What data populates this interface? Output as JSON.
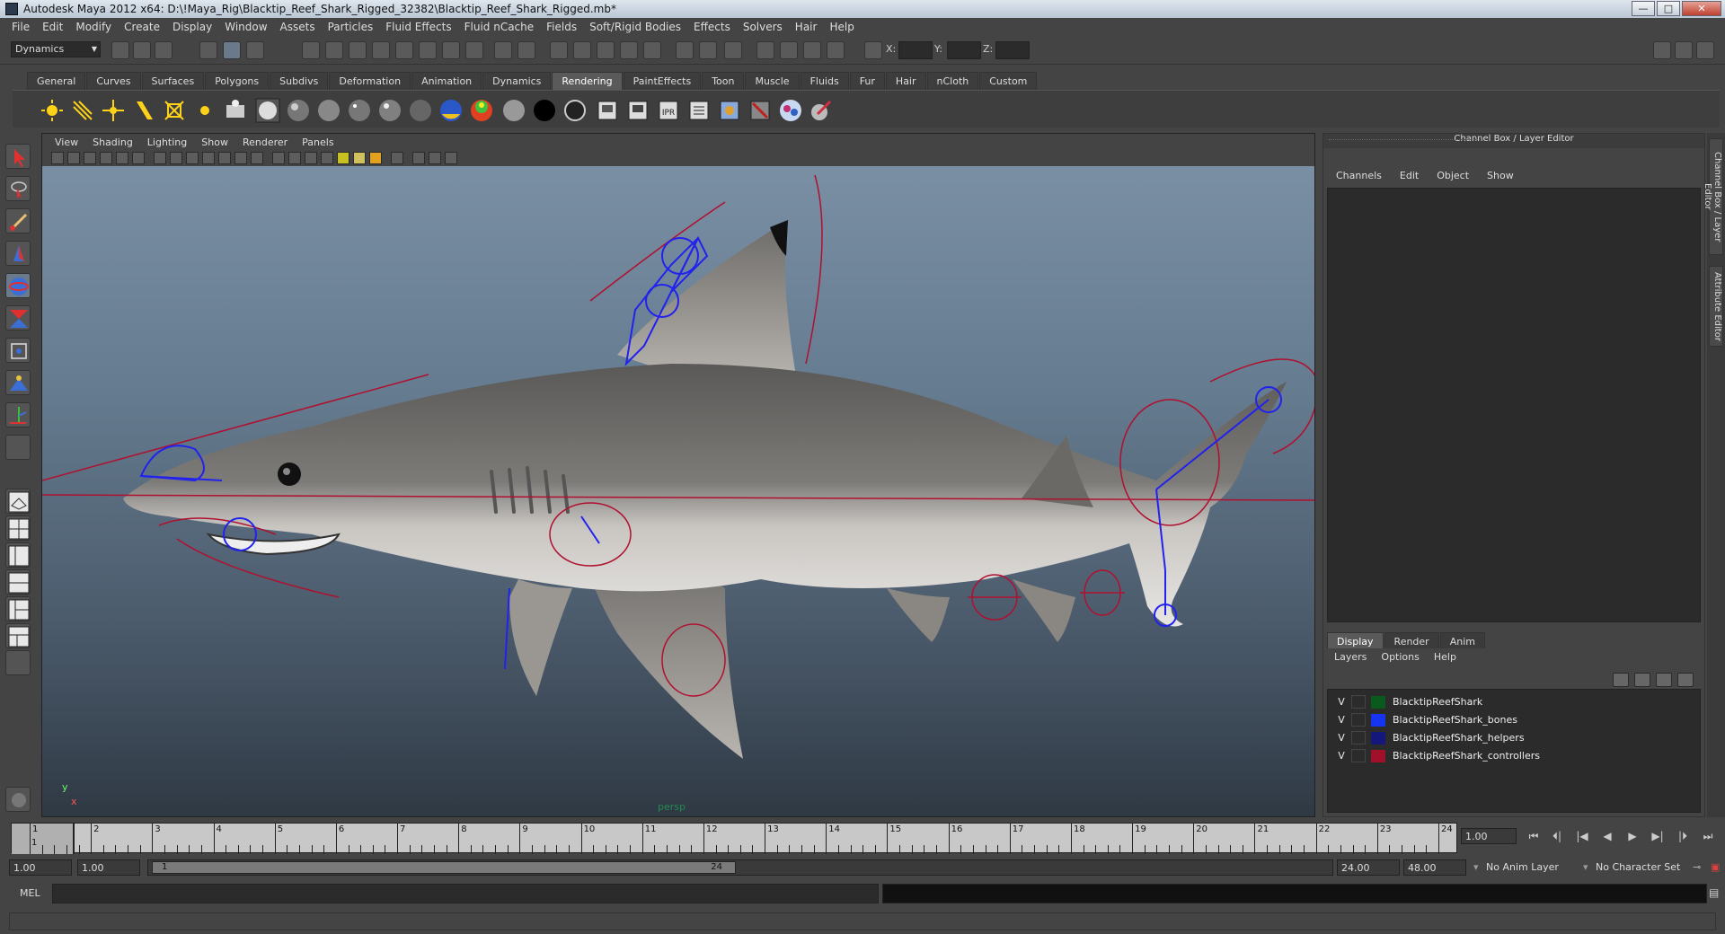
{
  "window": {
    "title": "Autodesk Maya 2012 x64: D:\\!Maya_Rig\\Blacktip_Reef_Shark_Rigged_32382\\Blacktip_Reef_Shark_Rigged.mb*",
    "minimize_label": "—",
    "maximize_label": "□",
    "close_label": "✕"
  },
  "menubar": [
    "File",
    "Edit",
    "Modify",
    "Create",
    "Display",
    "Window",
    "Assets",
    "Particles",
    "Fluid Effects",
    "Fluid nCache",
    "Fields",
    "Soft/Rigid Bodies",
    "Effects",
    "Solvers",
    "Hair",
    "Help"
  ],
  "statusline": {
    "mode": "Dynamics",
    "x_label": "X:",
    "y_label": "Y:",
    "z_label": "Z:"
  },
  "shelf": {
    "tabs": [
      "General",
      "Curves",
      "Surfaces",
      "Polygons",
      "Subdivs",
      "Deformation",
      "Animation",
      "Dynamics",
      "Rendering",
      "PaintEffects",
      "Toon",
      "Muscle",
      "Fluids",
      "Fur",
      "Hair",
      "nCloth",
      "Custom"
    ],
    "active_tab": "Rendering",
    "icons": [
      "ambient-light",
      "directional-light",
      "point-light",
      "spot-light",
      "area-light",
      "volume-light",
      "hypershade",
      "render-sphere",
      "blinn-sphere",
      "lambert-sphere",
      "phong-sphere",
      "phonge-sphere",
      "ramp-sphere",
      "color-sphere",
      "gray-sphere",
      "black-sphere",
      "hollow-sphere",
      "render-view",
      "render-current",
      "ipr-render",
      "render-settings",
      "batch-render",
      "cancel-render",
      "mental-ray",
      "paint-render"
    ]
  },
  "viewport": {
    "menu": [
      "View",
      "Shading",
      "Lighting",
      "Show",
      "Renderer",
      "Panels"
    ],
    "camera": "persp",
    "axis_y": "y",
    "axis_x": "x"
  },
  "channel_box": {
    "title": "Channel Box / Layer Editor",
    "menu": [
      "Channels",
      "Edit",
      "Object",
      "Show"
    ],
    "layer_tabs": [
      "Display",
      "Render",
      "Anim"
    ],
    "active_layer_tab": "Display",
    "layer_menu": [
      "Layers",
      "Options",
      "Help"
    ],
    "layers": [
      {
        "visible": "V",
        "name": "BlacktipReefShark",
        "color": "#0a5a1e"
      },
      {
        "visible": "V",
        "name": "BlacktipReefShark_bones",
        "color": "#1535f0"
      },
      {
        "visible": "V",
        "name": "BlacktipReefShark_helpers",
        "color": "#14187a"
      },
      {
        "visible": "V",
        "name": "BlacktipReefShark_controllers",
        "color": "#a0102a"
      }
    ]
  },
  "side_tabs": [
    "Channel Box / Layer Editor",
    "Attribute Editor"
  ],
  "timeline": {
    "ticks": [
      "1",
      "2",
      "3",
      "4",
      "5",
      "6",
      "7",
      "8",
      "9",
      "10",
      "11",
      "12",
      "13",
      "14",
      "15",
      "16",
      "17",
      "18",
      "19",
      "20",
      "21",
      "22",
      "23",
      "24"
    ],
    "current_frame_label": "1",
    "current_frame": "1.00"
  },
  "range": {
    "start": "1.00",
    "playback_start": "1.00",
    "range_start": "1",
    "range_end": "24",
    "playback_end": "24.00",
    "end": "48.00",
    "anim_layer": "No Anim Layer",
    "character_set": "No Character Set"
  },
  "playback": {
    "go_start": "⏮",
    "step_back_key": "⏴|",
    "step_back": "|◀",
    "play_back": "◀",
    "play_forward": "▶",
    "step_forward": "▶|",
    "step_forward_key": "|⏵",
    "go_end": "⏭"
  },
  "cmdline": {
    "label": "MEL"
  },
  "colors": {
    "accent": "#5a5a5a",
    "joint": "#2222ee",
    "control": "#b01030"
  }
}
